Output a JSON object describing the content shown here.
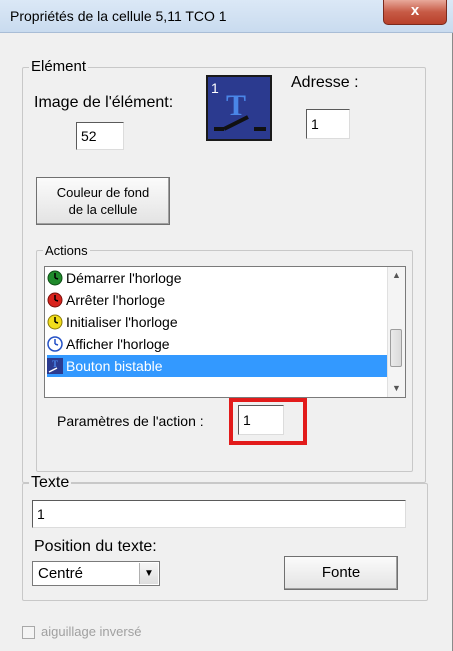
{
  "window": {
    "title": "Propriétés de la cellule 5,11 TCO 1",
    "close_label": "x"
  },
  "element_group": {
    "legend": "Elément",
    "image_label": "Image de l'élément:",
    "image_value": "52",
    "address_label": "Adresse :",
    "address_value": "1",
    "icon_number": "1",
    "icon_letter": "T",
    "bg_color_button_line1": "Couleur de fond",
    "bg_color_button_line2": "de la cellule"
  },
  "actions_group": {
    "legend": "Actions",
    "items": [
      {
        "label": "Démarrer l'horloge",
        "icon": "green-clock-icon",
        "color": "#1f8a2b"
      },
      {
        "label": "Arrêter l'horloge",
        "icon": "red-clock-icon",
        "color": "#d8231d"
      },
      {
        "label": "Initialiser l'horloge",
        "icon": "yellow-clock-icon",
        "color": "#f2de1c"
      },
      {
        "label": "Afficher l'horloge",
        "icon": "blue-clock-outline-icon",
        "color": "#2451c6"
      },
      {
        "label": "Bouton bistable",
        "icon": "bistable-switch-icon",
        "color": "#2b3a8f",
        "selected": true
      }
    ],
    "params_label": "Paramètres de l'action :",
    "params_value": "1"
  },
  "text_group": {
    "legend": "Texte",
    "text_value": "1",
    "position_label": "Position du texte:",
    "position_value": "Centré",
    "font_button": "Fonte"
  },
  "inverted_switch_label": "aiguillage inversé",
  "colors": {
    "highlight": "#e21b1b",
    "selection": "#3399ff"
  }
}
